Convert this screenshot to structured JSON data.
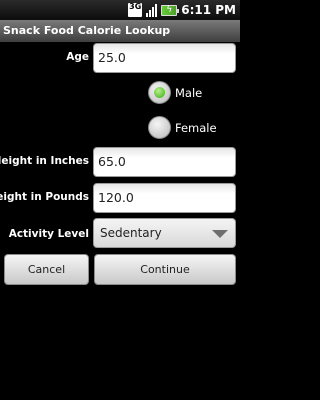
{
  "status_bar": {
    "network": "3G",
    "signal_icon": "signal-bars-icon",
    "battery_icon": "battery-charging-icon",
    "time": "6:11 PM"
  },
  "app": {
    "title": "Snack Food Calorie Lookup"
  },
  "form": {
    "age": {
      "label": "Age",
      "value": "25.0"
    },
    "gender": {
      "options": [
        {
          "label": "Male",
          "selected": true
        },
        {
          "label": "Female",
          "selected": false
        }
      ]
    },
    "height": {
      "label": "Height in Inches",
      "value": "65.0"
    },
    "weight": {
      "label": "Weight in Pounds",
      "value": "120.0"
    },
    "activity": {
      "label": "Activity Level",
      "selected": "Sedentary"
    }
  },
  "buttons": {
    "cancel": "Cancel",
    "continue": "Continue"
  },
  "colors": {
    "radio_selected": "#3aa714",
    "title_bar": "#5a5a5a",
    "background": "#000000"
  }
}
